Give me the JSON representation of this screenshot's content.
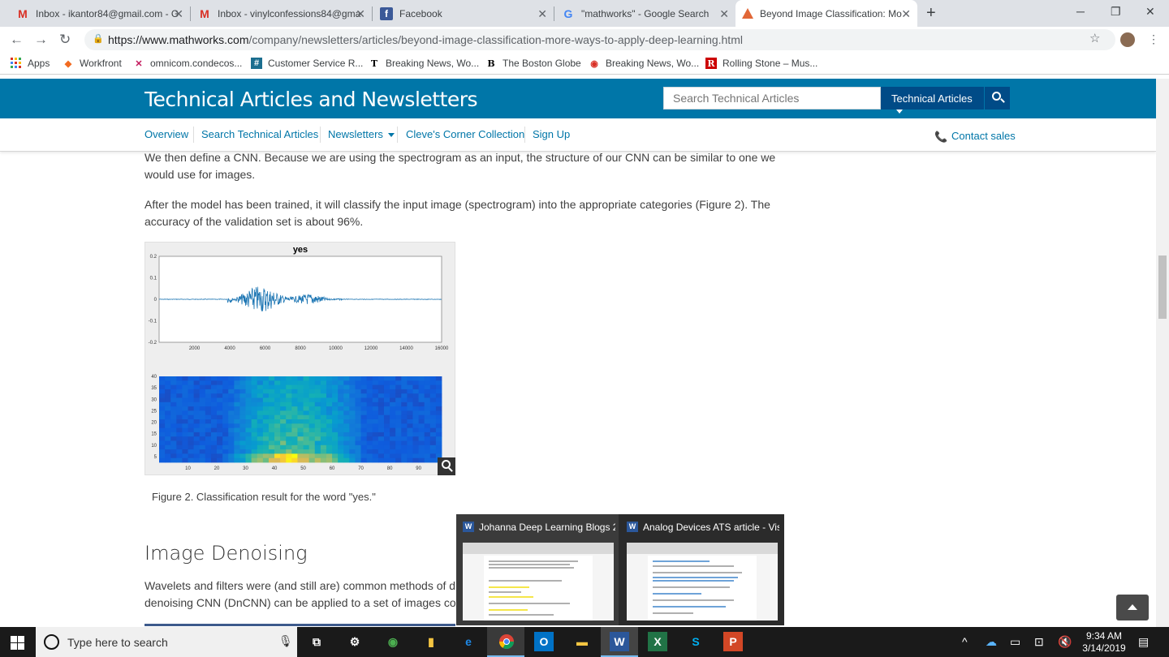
{
  "browser": {
    "tabs": [
      {
        "title": "Inbox - ikantor84@gmail.com - G",
        "favicon": "gmail-icon",
        "active": false
      },
      {
        "title": "Inbox - vinylconfessions84@gma",
        "favicon": "gmail-icon",
        "active": false
      },
      {
        "title": "Facebook",
        "favicon": "facebook-icon",
        "active": false
      },
      {
        "title": "\"mathworks\" - Google Search",
        "favicon": "google-icon",
        "active": false
      },
      {
        "title": "Beyond Image Classification: Mo",
        "favicon": "mathworks-icon",
        "active": true
      }
    ],
    "url_host": "https://www.mathworks.com",
    "url_path": "/company/newsletters/articles/beyond-image-classification-more-ways-to-apply-deep-learning.html",
    "bookmarks": [
      {
        "label": "Apps",
        "icon": "apps-grid-icon"
      },
      {
        "label": "Workfront",
        "icon": "workfront-icon"
      },
      {
        "label": "omnicom.condecos...",
        "icon": "condeco-icon"
      },
      {
        "label": "Customer Service R...",
        "icon": "service-icon"
      },
      {
        "label": "Breaking News, Wo...",
        "icon": "nyt-icon"
      },
      {
        "label": "The Boston Globe",
        "icon": "globe-icon"
      },
      {
        "label": "Breaking News, Wo...",
        "icon": "news-icon"
      },
      {
        "label": "Rolling Stone – Mus...",
        "icon": "rollingstone-icon"
      }
    ]
  },
  "site": {
    "title": "Technical Articles and Newsletters",
    "search_placeholder": "Search Technical Articles",
    "search_scope": "Technical Articles",
    "nav": [
      "Overview",
      "Search Technical Articles",
      "Newsletters",
      "Cleve's Corner Collection",
      "Sign Up"
    ],
    "contact": "Contact sales"
  },
  "article": {
    "para1": "We then define a CNN. Because we are using the spectrogram as an input, the structure of our CNN can be similar to one we would use for images.",
    "para2": "After the model has been trained, it will classify the input image (spectrogram) into the appropriate categories (Figure 2). The accuracy of the validation set is about 96%.",
    "figure_caption": "Figure 2. Classification result for the word \"yes.\"",
    "heading": "Image Denoising",
    "para3_line1": "Wavelets and filters were (and still are) common methods of d",
    "para3_line2": "denoising CNN (DnCNN) can be applied to a set of images co"
  },
  "chart_data": [
    {
      "type": "line",
      "title": "yes",
      "xlim": [
        0,
        16000
      ],
      "ylim": [
        -0.2,
        0.2
      ],
      "xticks": [
        "2000",
        "4000",
        "6000",
        "8000",
        "10000",
        "12000",
        "14000",
        "16000"
      ],
      "yticks": [
        "0.2",
        "0.1",
        "0",
        "-0.1",
        "-0.2"
      ],
      "color": "#1f77b4"
    },
    {
      "type": "heatmap",
      "xlim": [
        0,
        98
      ],
      "ylim": [
        0,
        40
      ],
      "xticks": [
        "10",
        "20",
        "30",
        "40",
        "50",
        "60",
        "70",
        "80",
        "90"
      ],
      "yticks": [
        "40",
        "35",
        "30",
        "25",
        "20",
        "15",
        "10",
        "5"
      ],
      "colormap": "parula"
    }
  ],
  "taskbar_popup": [
    {
      "title": "Johanna Deep Learning Blogs 2...",
      "app": "word"
    },
    {
      "title": "Analog Devices ATS article - Vis...",
      "app": "word"
    }
  ],
  "taskbar": {
    "search_placeholder": "Type here to search",
    "time": "9:34 AM",
    "date": "3/14/2019"
  },
  "colors": {
    "brand_blue": "#0076a8",
    "dark_blue": "#004b87",
    "link": "#0076a8"
  }
}
